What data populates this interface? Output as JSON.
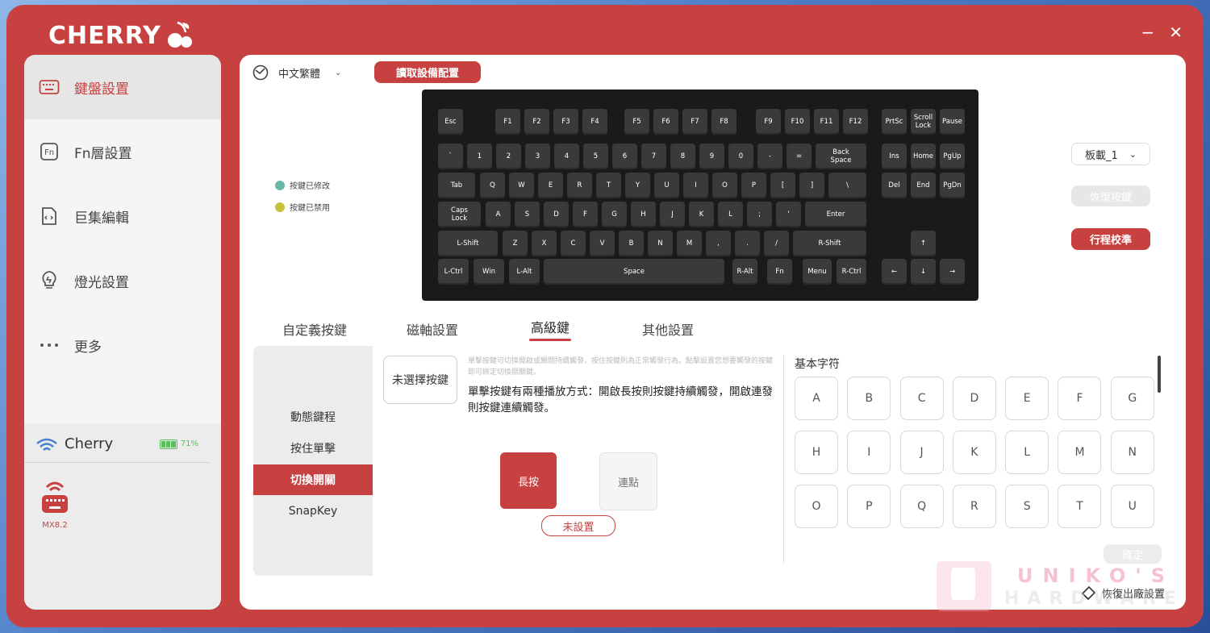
{
  "app": {
    "brand": "CHERRY",
    "minimize": "−",
    "close": "✕"
  },
  "sidebar": {
    "items": [
      {
        "label": "鍵盤設置",
        "icon": "keyboard-icon"
      },
      {
        "label": "Fn層設置",
        "icon": "fn-icon"
      },
      {
        "label": "巨集編輯",
        "icon": "macro-file-icon"
      },
      {
        "label": "燈光設置",
        "icon": "bulb-icon"
      },
      {
        "label": "更多",
        "icon": "more-dots-icon"
      }
    ],
    "device": {
      "name": "Cherry",
      "battery": "71%",
      "model": "MX8.2"
    }
  },
  "toolbar": {
    "language": "中文繁體",
    "read_config": "讀取設備配置"
  },
  "legend": {
    "modified": "按鍵已修改",
    "disabled": "按鍵已禁用",
    "modified_color": "#6ab7a8",
    "disabled_color": "#c6c23a"
  },
  "keys": [
    "Esc",
    "F1",
    "F2",
    "F3",
    "F4",
    "F5",
    "F6",
    "F7",
    "F8",
    "F9",
    "F10",
    "F11",
    "F12",
    "PrtSc",
    "Scroll Lock",
    "Pause",
    "`",
    "1",
    "2",
    "3",
    "4",
    "5",
    "6",
    "7",
    "8",
    "9",
    "0",
    "-",
    "=",
    "Back Space",
    "Ins",
    "Home",
    "PgUp",
    "Tab",
    "Q",
    "W",
    "E",
    "R",
    "T",
    "Y",
    "U",
    "I",
    "O",
    "P",
    "[",
    "]",
    "\\",
    "Del",
    "End",
    "PgDn",
    "Caps Lock",
    "A",
    "S",
    "D",
    "F",
    "G",
    "H",
    "J",
    "K",
    "L",
    ";",
    "'",
    "Enter",
    "L-Shift",
    "Z",
    "X",
    "C",
    "V",
    "B",
    "N",
    "M",
    ",",
    ".",
    "/",
    "R-Shift",
    "↑",
    "L-Ctrl",
    "Win",
    "L-Alt",
    "Space",
    "R-Alt",
    "Fn",
    "Menu",
    "R-Ctrl",
    "←",
    "↓",
    "→"
  ],
  "right": {
    "profile": "板載_1",
    "restore_key": "恢復按鍵",
    "travel_calibrate": "行程校準"
  },
  "tabs": [
    "自定義按鍵",
    "磁軸設置",
    "高級鍵",
    "其他設置"
  ],
  "subnav": [
    "動態鍵程",
    "按住單擊",
    "切換開關",
    "SnapKey"
  ],
  "advanced": {
    "no_key": "未選擇按鍵",
    "hint": "單擊按鍵可切換開啟或關閉持續觸發，按住按鍵則為正常觸發行為。點擊設置您想要觸發的按鍵即可綁定切換開關鍵。",
    "desc": "單擊按鍵有兩種播放方式：開啟長按則按鍵持續觸發，開啟連發則按鍵連續觸發。",
    "hold": "長按",
    "repeat": "連點",
    "unset": "未設置"
  },
  "chars": {
    "title": "基本字符",
    "keys": [
      "A",
      "B",
      "C",
      "D",
      "E",
      "F",
      "G",
      "H",
      "I",
      "J",
      "K",
      "L",
      "M",
      "N",
      "O",
      "P",
      "Q",
      "R",
      "S",
      "T",
      "U"
    ],
    "confirm": "確定"
  },
  "footer": {
    "factory_reset": "恢復出廠設置"
  },
  "watermark": {
    "line1": "UNIKO'S",
    "line2": "HARDWARE"
  },
  "colors": {
    "accent": "#c84141"
  }
}
